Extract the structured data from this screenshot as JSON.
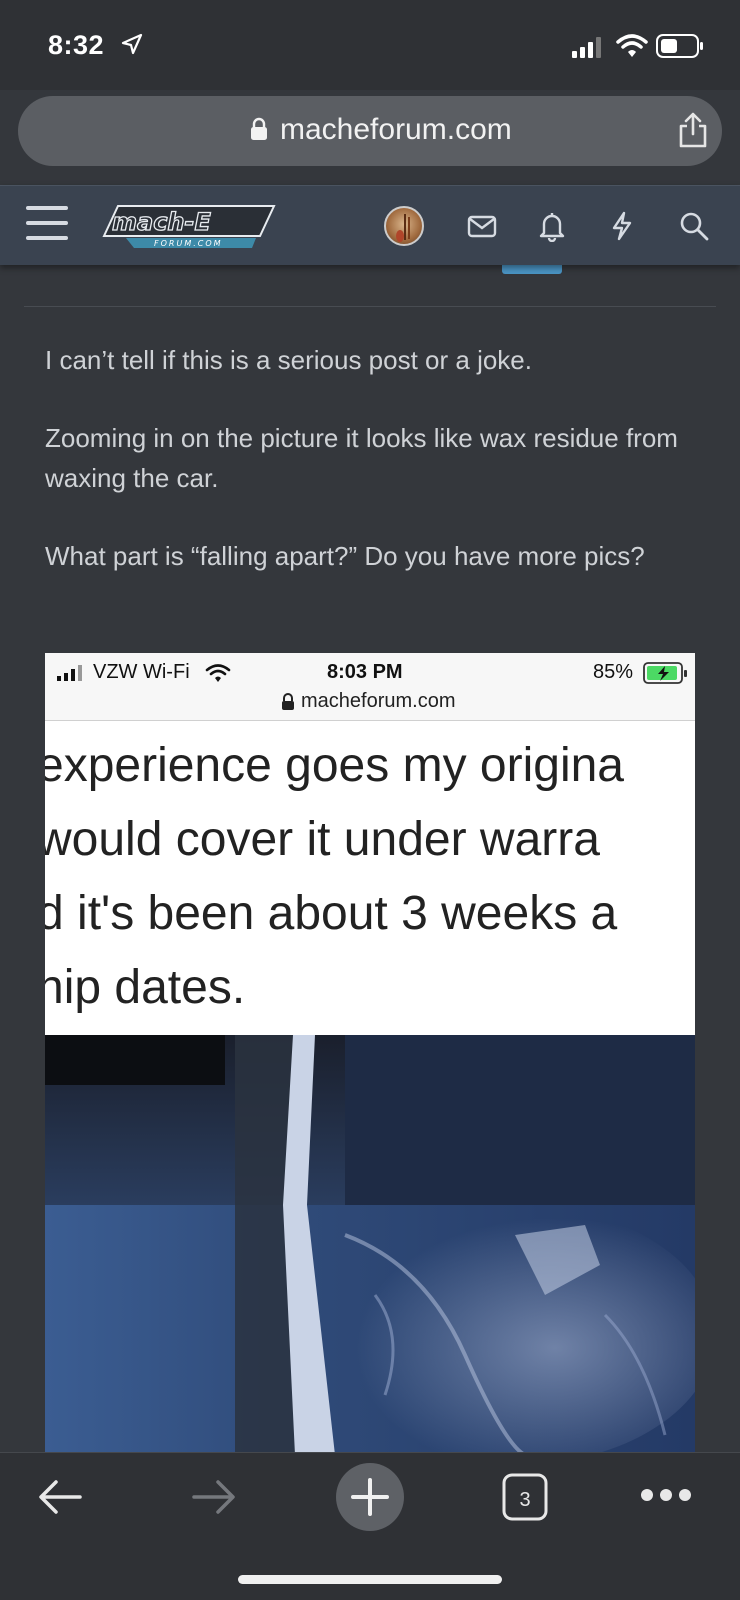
{
  "status_bar": {
    "time": "8:32",
    "icons": [
      "location-arrow-icon",
      "cell-signal-icon",
      "wifi-icon",
      "battery-icon"
    ]
  },
  "browser": {
    "url": "macheforum.com",
    "icons": [
      "lock-icon",
      "share-icon"
    ]
  },
  "site_header": {
    "logo_text": "mach-E",
    "logo_subtext": "FORUM.COM",
    "icons": [
      "menu-icon",
      "avatar",
      "mail-icon",
      "bell-icon",
      "lightning-icon",
      "search-icon"
    ]
  },
  "post": {
    "paragraphs": [
      "I can’t tell if this is a serious post or a joke.",
      "Zooming in on the picture it looks like wax residue from waxing the car.",
      "What part is “falling apart?” Do you have more pics?"
    ]
  },
  "embedded_screenshot": {
    "carrier": "VZW Wi-Fi",
    "time": "8:03 PM",
    "battery": "85%",
    "url": "macheforum.com",
    "text_lines": [
      "experience goes my origina",
      " would cover it under warra",
      "d it's been about 3 weeks a",
      "hip dates."
    ]
  },
  "toolbar": {
    "tabs_count": "3",
    "icons": [
      "back-arrow-icon",
      "forward-arrow-icon",
      "new-tab-plus-icon",
      "tabs-icon",
      "more-icon"
    ]
  },
  "colors": {
    "page_bg": "#34373c",
    "header_bg": "#3a4350",
    "accent": "#4a94c4"
  }
}
